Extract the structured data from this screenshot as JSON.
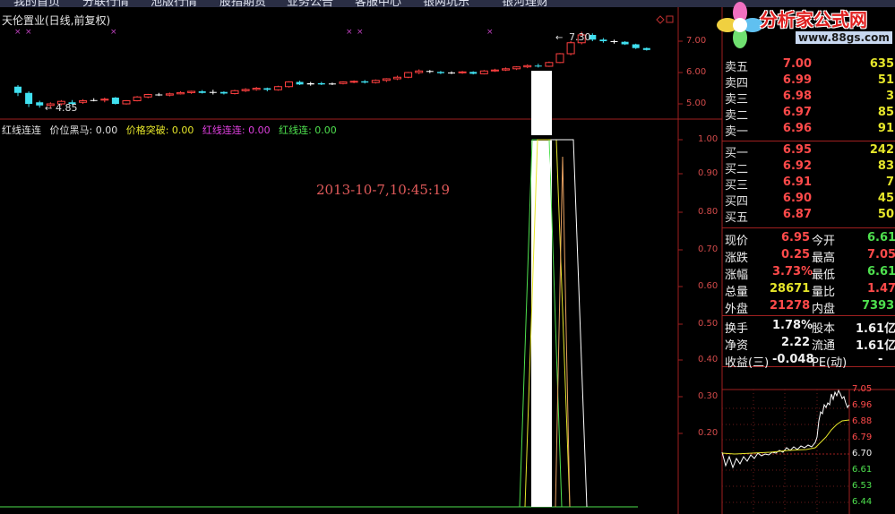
{
  "menu": {
    "items": [
      "我的首页",
      "分联行情",
      "池版行情",
      "股指期货",
      "业务公告",
      "客服中心",
      "银两坑乐",
      "银河理财"
    ]
  },
  "stock": {
    "title": "天伦置业(日线,前复权)"
  },
  "main_chart": {
    "high_label": "7.30",
    "low_label": "4.85",
    "price_axis": [
      "7.00",
      "6.00",
      "5.00"
    ]
  },
  "indicator": {
    "legend": [
      {
        "text": "红线连连",
        "color": "#e0e0e0"
      },
      {
        "text": "价位黑马: 0.00",
        "color": "#e0e0e0"
      },
      {
        "text": "价格突破: 0.00",
        "color": "#e6e62a"
      },
      {
        "text": "红线连连: 0.00",
        "color": "#e040e0"
      },
      {
        "text": "红线连: 0.00",
        "color": "#4ee04e"
      }
    ],
    "axis": [
      "1.00",
      "0.90",
      "0.80",
      "0.70",
      "0.60",
      "0.50",
      "0.40",
      "0.30",
      "0.20"
    ],
    "timestamp": "2013-10-7,10:45:19"
  },
  "order_book": {
    "asks": [
      {
        "name": "卖五",
        "price": "7.00",
        "vol": "635"
      },
      {
        "name": "卖四",
        "price": "6.99",
        "vol": "51"
      },
      {
        "name": "卖三",
        "price": "6.98",
        "vol": "3"
      },
      {
        "name": "卖二",
        "price": "6.97",
        "vol": "85"
      },
      {
        "name": "卖一",
        "price": "6.96",
        "vol": "91"
      }
    ],
    "bids": [
      {
        "name": "买一",
        "price": "6.95",
        "vol": "242"
      },
      {
        "name": "买二",
        "price": "6.92",
        "vol": "83"
      },
      {
        "name": "买三",
        "price": "6.91",
        "vol": "7"
      },
      {
        "name": "买四",
        "price": "6.90",
        "vol": "45"
      },
      {
        "name": "买五",
        "price": "6.87",
        "vol": "50"
      }
    ]
  },
  "quote": {
    "now_label": "现价",
    "now": "6.95",
    "open_label": "今开",
    "open": "6.61",
    "chg_label": "涨跌",
    "chg": "0.25",
    "high_label": "最高",
    "high": "7.05",
    "pct_label": "涨幅",
    "pct": "3.73%",
    "low_label": "最低",
    "low": "6.61",
    "vol_label": "总量",
    "vol": "28671",
    "vr_label": "量比",
    "vr": "1.47",
    "out_label": "外盘",
    "out": "21278",
    "in_label": "内盘",
    "in": "7393",
    "turn_label": "换手",
    "turn": "1.78%",
    "cap_label": "股本",
    "cap": "1.61亿",
    "nav_label": "净资",
    "nav": "2.22",
    "float_label": "流通",
    "float": "1.61亿",
    "eps_label": "收益(三)",
    "eps": "-0.048",
    "pe_label": "PE(动)",
    "pe": "-"
  },
  "mini_chart": {
    "labels": [
      {
        "t": "7.05",
        "c": "red"
      },
      {
        "t": "6.96",
        "c": "red"
      },
      {
        "t": "6.88",
        "c": "red"
      },
      {
        "t": "6.79",
        "c": "red"
      },
      {
        "t": "6.70",
        "c": "white"
      },
      {
        "t": "6.61",
        "c": "green"
      },
      {
        "t": "6.53",
        "c": "green"
      },
      {
        "t": "6.44",
        "c": "green"
      }
    ]
  },
  "logo": {
    "text": "分析家公式网",
    "url": "www.88gs.com"
  }
}
